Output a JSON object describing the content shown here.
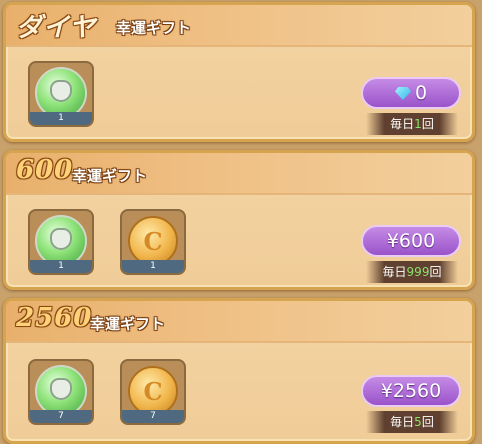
{
  "panels": [
    {
      "title_big": "ダイヤ",
      "title_small": "幸運ギフト",
      "items": [
        {
          "icon": "wolf-orb-icon",
          "count": "1"
        }
      ],
      "price": "0",
      "price_icon": "diamond-icon",
      "limit_prefix": "毎日",
      "limit_num": "1",
      "limit_suffix": "回"
    },
    {
      "title_big": "600",
      "title_small": "幸運ギフト",
      "items": [
        {
          "icon": "wolf-orb-icon",
          "count": "1"
        },
        {
          "icon": "gold-coin-icon",
          "count": "1"
        }
      ],
      "price": "¥600",
      "limit_prefix": "毎日",
      "limit_num": "999",
      "limit_suffix": "回"
    },
    {
      "title_big": "2560",
      "title_small": "幸運ギフト",
      "items": [
        {
          "icon": "wolf-orb-icon",
          "count": "7"
        },
        {
          "icon": "gold-coin-icon",
          "count": "7"
        }
      ],
      "price": "¥2560",
      "limit_prefix": "毎日",
      "limit_num": "5",
      "limit_suffix": "回"
    }
  ],
  "colors": {
    "price_button": "#a55fd0",
    "limit_highlight": "#8be06a",
    "panel_border": "#d6a34f"
  }
}
